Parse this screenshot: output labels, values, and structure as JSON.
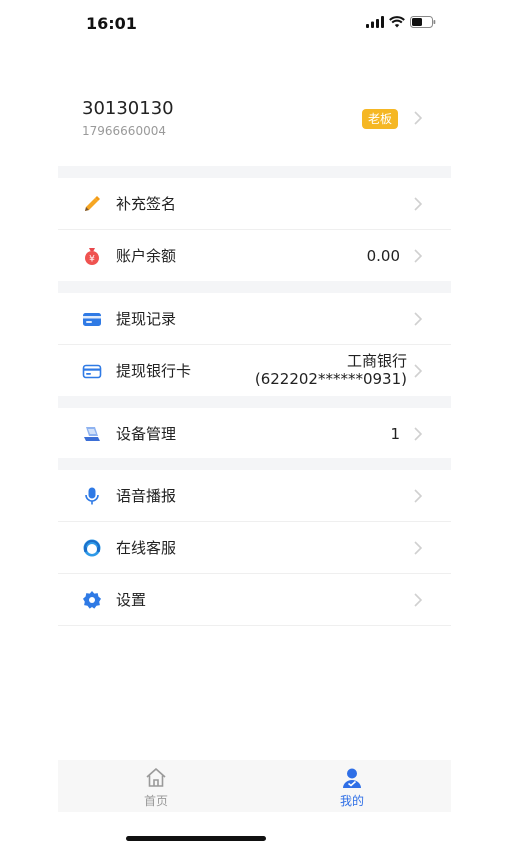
{
  "status": {
    "time": "16:01"
  },
  "profile": {
    "name": "30130130",
    "phone": "17966660004",
    "role_badge": "老板"
  },
  "menu": {
    "signature": {
      "label": "补充签名"
    },
    "balance": {
      "label": "账户余额",
      "value": "0.00"
    },
    "withdraw_records": {
      "label": "提现记录"
    },
    "bank_card": {
      "label": "提现银行卡",
      "bank_name": "工商银行",
      "card_number": "(622202******0931)"
    },
    "devices": {
      "label": "设备管理",
      "value": "1"
    },
    "voice": {
      "label": "语音播报"
    },
    "support": {
      "label": "在线客服"
    },
    "settings": {
      "label": "设置"
    }
  },
  "tabbar": {
    "home": "首页",
    "mine": "我的"
  },
  "colors": {
    "accent": "#2f6fe6",
    "badge": "#f5b724",
    "divider": "#f4f5f7"
  }
}
